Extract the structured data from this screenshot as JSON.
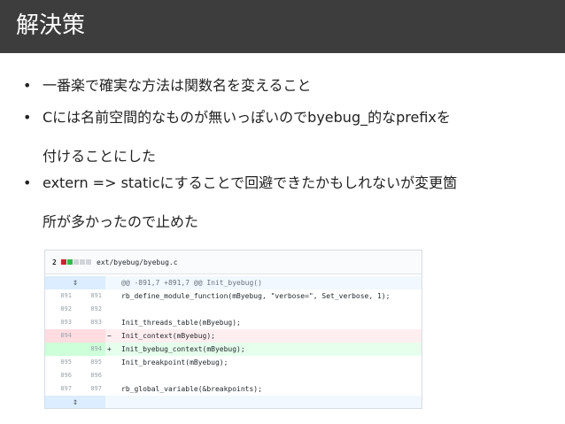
{
  "slide": {
    "title": "解決策",
    "bullets": [
      {
        "lines": [
          "一番楽で確実な方法は関数名を変えること"
        ]
      },
      {
        "lines": [
          "Cには名前空間的なものが無いっぽいのでbyebug_的なprefixを",
          "付けることにした"
        ]
      },
      {
        "lines": [
          "extern => staticにすることで回避できたかもしれないが変更箇",
          "所が多かったので止めた"
        ]
      }
    ],
    "bullet_symbol": "•"
  },
  "diff": {
    "file": {
      "changes": "2",
      "path": "ext/byebug/byebug.c",
      "bar_colors": [
        "#cb2431",
        "#2cbe4e",
        "#d1d5da",
        "#d1d5da",
        "#d1d5da"
      ]
    },
    "expand_icon": "↕",
    "rows": [
      {
        "type": "hunk",
        "old": "",
        "new": "",
        "sign": "",
        "code": "@@ -891,7 +891,7 @@ Init_byebug()"
      },
      {
        "type": "ctx",
        "old": "891",
        "new": "891",
        "sign": "",
        "code": "rb_define_module_function(mByebug, \"verbose=\", Set_verbose, 1);"
      },
      {
        "type": "ctx",
        "old": "892",
        "new": "892",
        "sign": "",
        "code": ""
      },
      {
        "type": "ctx",
        "old": "893",
        "new": "893",
        "sign": "",
        "code": "Init_threads_table(mByebug);"
      },
      {
        "type": "del",
        "old": "894",
        "new": "",
        "sign": "−",
        "code": "Init_context(mByebug);"
      },
      {
        "type": "add",
        "old": "",
        "new": "894",
        "sign": "+",
        "code": "Init_byebug_context(mByebug);"
      },
      {
        "type": "ctx",
        "old": "895",
        "new": "895",
        "sign": "",
        "code": "Init_breakpoint(mByebug);"
      },
      {
        "type": "ctx",
        "old": "896",
        "new": "896",
        "sign": "",
        "code": ""
      },
      {
        "type": "ctx",
        "old": "897",
        "new": "897",
        "sign": "",
        "code": "rb_global_variable(&breakpoints);"
      },
      {
        "type": "hunk-end",
        "old": "",
        "new": "",
        "sign": "",
        "code": ""
      }
    ]
  }
}
